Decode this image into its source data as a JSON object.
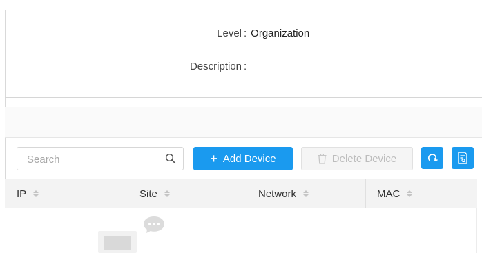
{
  "details": {
    "level_label": "Level",
    "level_value": "Organization",
    "description_label": "Description",
    "description_value": ""
  },
  "toolbar": {
    "search_placeholder": "Search",
    "search_icon": "magnifier-icon",
    "add_label": "Add Device",
    "delete_label": "Delete Device",
    "refresh_icon": "refresh-icon",
    "export_icon": "export-report-icon"
  },
  "table": {
    "columns": [
      "IP",
      "Site",
      "Network",
      "MAC"
    ],
    "rows": []
  },
  "colors": {
    "primary": "#1a9aef",
    "disabled_text": "#bdbdbd",
    "header_bg": "#f3f3f3"
  }
}
